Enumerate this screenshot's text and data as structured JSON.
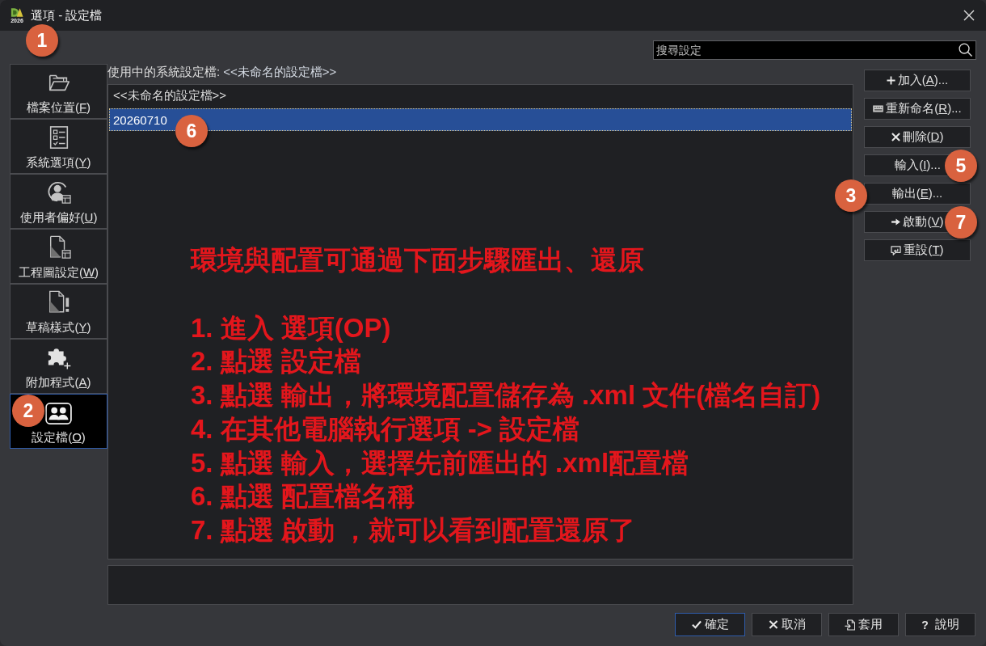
{
  "window": {
    "title": "選項 - 設定檔",
    "logo_text": "2026",
    "marker": "1"
  },
  "search": {
    "placeholder": "搜尋設定"
  },
  "sidebar": {
    "items": [
      {
        "label": "檔案位置(",
        "access_key": "F",
        "label_end": ")",
        "selected": false
      },
      {
        "label": "系統選項(",
        "access_key": "Y",
        "label_end": ")",
        "selected": false
      },
      {
        "label": "使用者偏好(",
        "access_key": "U",
        "label_end": ")",
        "selected": false
      },
      {
        "label": "工程圖設定(",
        "access_key": "W",
        "label_end": ")",
        "selected": false
      },
      {
        "label": "草稿樣式(",
        "access_key": "Y",
        "label_end": ")",
        "selected": false
      },
      {
        "label": "附加程式(",
        "access_key": "A",
        "label_end": ")",
        "selected": false
      },
      {
        "label": "設定檔(",
        "access_key": "O",
        "label_end": ")",
        "selected": true,
        "marker": "2"
      }
    ]
  },
  "active_profile": {
    "label": "使用中的系統設定檔:",
    "value": "<<未命名的設定檔>>"
  },
  "profiles": {
    "items": [
      {
        "label": "<<未命名的設定檔>>",
        "selected": false
      },
      {
        "label": "20260710",
        "selected": true,
        "marker": "6"
      }
    ]
  },
  "annotation": {
    "heading": "環境與配置可通過下面步驟匯出、還原",
    "steps": [
      "1. 進入 選項(OP)",
      "2. 點選 設定檔",
      "3. 點選 輸出，將環境配置儲存為 .xml 文件(檔名自訂)",
      "4. 在其他電腦執行選項 -> 設定檔",
      "5. 點選 輸入，選擇先前匯出的 .xml配置檔",
      "6. 點選 配置檔名稱",
      "7. 點選 啟動 ，就可以看到配置還原了"
    ]
  },
  "profile_buttons": [
    {
      "label": "加入(",
      "access_key": "A",
      "label_end": ")..."
    },
    {
      "label": "重新命名(",
      "access_key": "R",
      "label_end": ")..."
    },
    {
      "label": "刪除(",
      "access_key": "D",
      "label_end": ")"
    },
    {
      "label": "輸入(",
      "access_key": "I",
      "label_end": ")...",
      "marker": "5"
    },
    {
      "label": "輸出(",
      "access_key": "E",
      "label_end": ")...",
      "marker": "3"
    },
    {
      "label": "啟動(",
      "access_key": "V",
      "label_end": ")",
      "marker": "7"
    },
    {
      "label": "重設(",
      "access_key": "T",
      "label_end": ")"
    }
  ],
  "footer_buttons": [
    {
      "label": "確定",
      "focused": true
    },
    {
      "label": "取消",
      "focused": false
    },
    {
      "label": "套用",
      "focused": false
    },
    {
      "glyph": "?",
      "label": "說明",
      "focused": false
    }
  ]
}
